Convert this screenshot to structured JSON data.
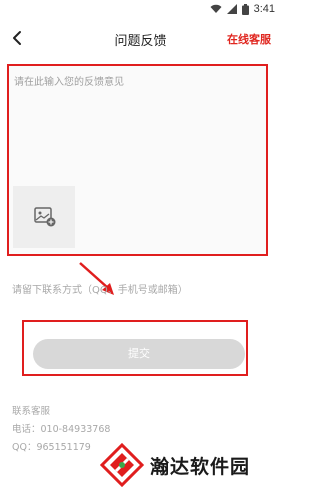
{
  "status": {
    "time": "3:41"
  },
  "header": {
    "title": "问题反馈",
    "online_service": "在线客服"
  },
  "feedback": {
    "placeholder": "请在此输入您的反馈意见"
  },
  "contact_input": {
    "placeholder": "请留下联系方式（QQ、手机号或邮箱）"
  },
  "submit": {
    "label": "提交"
  },
  "contact": {
    "heading": "联系客服",
    "phone": "电话：010-84933768",
    "qq": "QQ：965151179"
  },
  "watermark": {
    "text": "瀚达软件园"
  },
  "colors": {
    "accent": "#e0261f",
    "button": "#d8d8d8"
  }
}
